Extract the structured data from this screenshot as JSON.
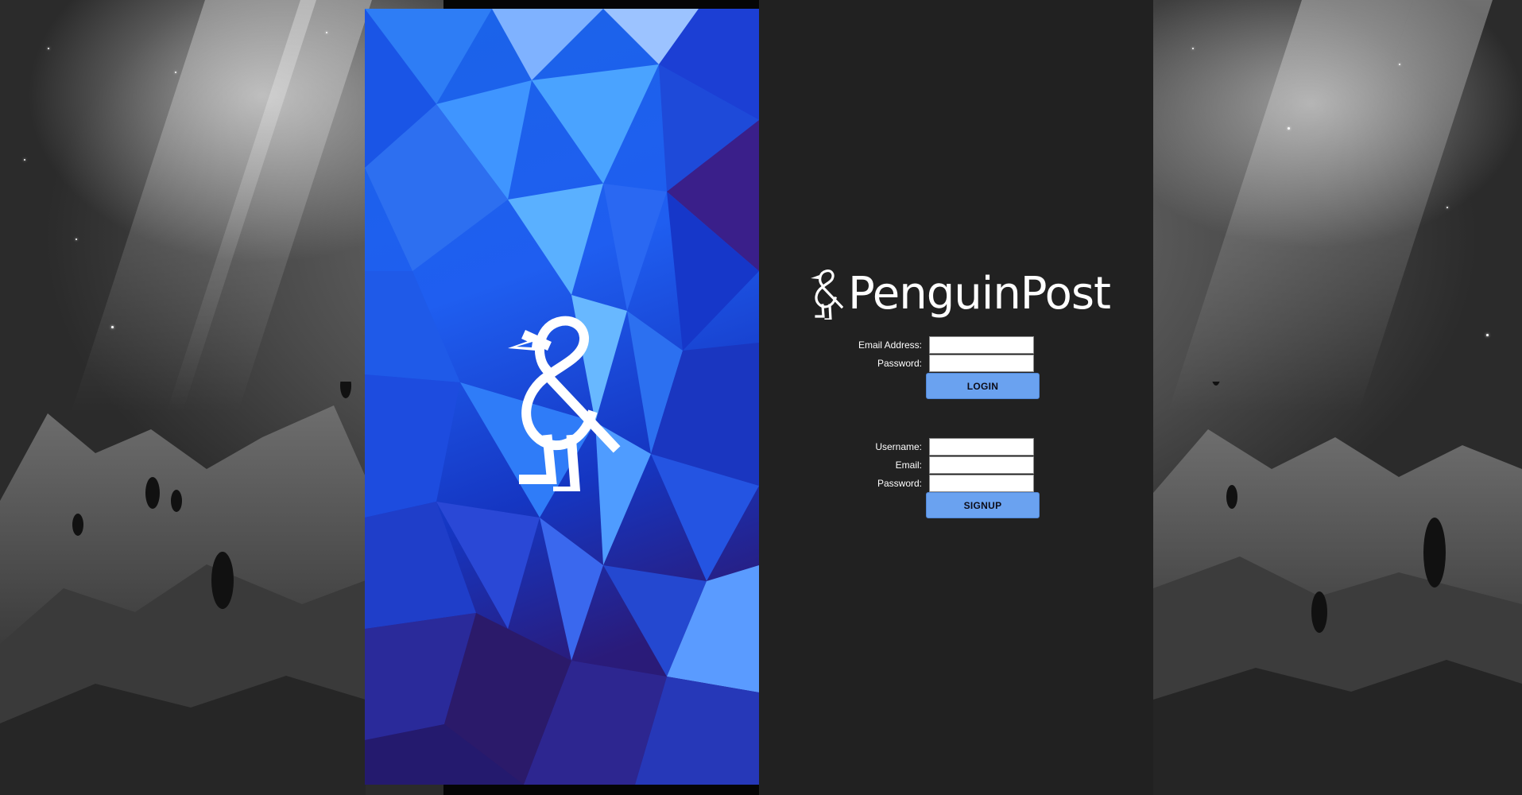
{
  "brand": {
    "name": "PenguinPost"
  },
  "login": {
    "email_label": "Email Address:",
    "password_label": "Password:",
    "email_value": "",
    "password_value": "",
    "button_label": "LOGIN"
  },
  "signup": {
    "username_label": "Username:",
    "email_label": "Email:",
    "password_label": "Password:",
    "username_value": "",
    "email_value": "",
    "password_value": "",
    "button_label": "SIGNUP"
  },
  "colors": {
    "dark_panel": "#212121",
    "button": "#6aa2f0",
    "art_blue": "#1f5ef0",
    "text": "#ffffff"
  },
  "icons": {
    "brand": "penguin-ampersand-icon",
    "art": "penguin-ampersand-icon"
  }
}
